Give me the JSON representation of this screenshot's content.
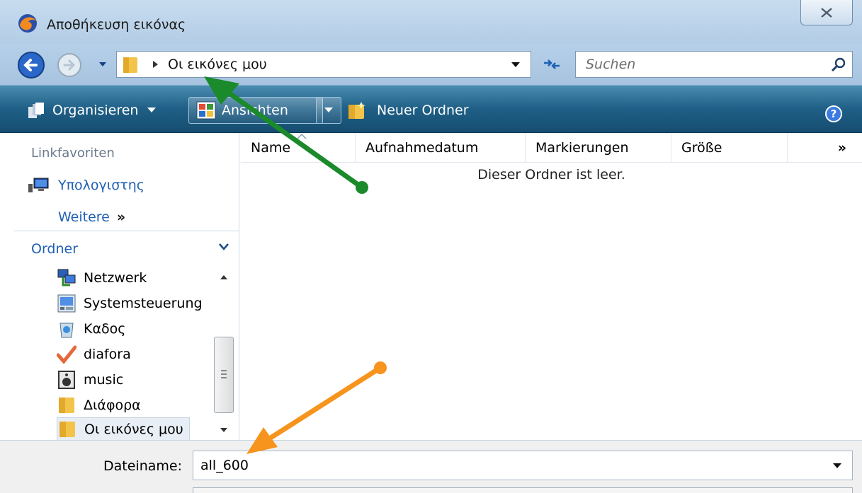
{
  "window": {
    "title": "Αποθήκευση εικόνας",
    "close_label": "✕"
  },
  "address": {
    "path": "Οι εικόνες μου",
    "search_placeholder": "Suchen"
  },
  "toolbar": {
    "organize": "Organisieren",
    "views": "Ansichten",
    "new_folder": "Neuer Ordner"
  },
  "sidebar": {
    "favorites_title": "Linkfavoriten",
    "favorite_computer": "Υπολογιστης",
    "more": "Weitere",
    "more_glyph": "»",
    "folders_title": "Ordner",
    "tree": [
      {
        "label": "Netzwerk",
        "icon": "network-icon"
      },
      {
        "label": "Systemsteuerung",
        "icon": "control-panel-icon"
      },
      {
        "label": "Καδος",
        "icon": "recycle-bin-icon"
      },
      {
        "label": "diafora",
        "icon": "checkmark-icon"
      },
      {
        "label": "music",
        "icon": "speaker-icon"
      },
      {
        "label": "Διάφορα",
        "icon": "folder-icon"
      },
      {
        "label": "Οι εικόνες μου",
        "icon": "folder-icon",
        "selected": true
      }
    ]
  },
  "list": {
    "columns": [
      "Name",
      "Aufnahmedatum",
      "Markierungen",
      "Größe"
    ],
    "more_columns": "»",
    "empty_message": "Dieser Ordner ist leer."
  },
  "save": {
    "filename_label": "Dateiname:",
    "filename_value": "all_600"
  },
  "colors": {
    "accent_link": "#1f5fb4",
    "toolbar": "#1f5f86",
    "arrow_green": "#1a8a2a",
    "arrow_orange": "#f7941d"
  }
}
